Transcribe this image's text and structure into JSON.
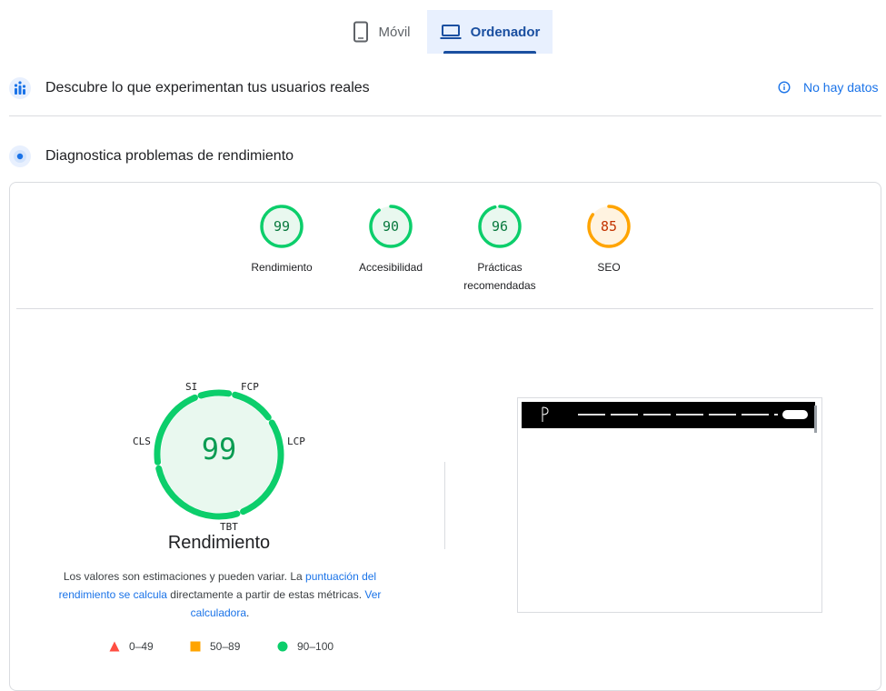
{
  "tabs": [
    {
      "label": "Móvil",
      "icon": "phone-icon",
      "selected": false
    },
    {
      "label": "Ordenador",
      "icon": "laptop-icon",
      "selected": true
    }
  ],
  "field_data": {
    "title": "Descubre lo que experimentan tus usuarios reales",
    "status": "No hay datos",
    "icon": "users-chart-icon"
  },
  "lab_data": {
    "title": "Diagnostica problemas de rendimiento",
    "icon": "diagnostics-icon"
  },
  "categories": [
    {
      "score": "99",
      "label": "Rendimiento",
      "color": "#0cce6b",
      "text_color": "#0a7a3f"
    },
    {
      "score": "90",
      "label": "Accesibilidad",
      "color": "#0cce6b",
      "text_color": "#0a7a3f"
    },
    {
      "score": "96",
      "label": "Prácticas recomendadas",
      "color": "#0cce6b",
      "text_color": "#0a7a3f"
    },
    {
      "score": "85",
      "label": "SEO",
      "color": "#ffa400",
      "text_color": "#c33300"
    }
  ],
  "performance": {
    "score": "99",
    "label": "Rendimiento",
    "metrics": [
      "SI",
      "FCP",
      "LCP",
      "TBT",
      "CLS"
    ],
    "note_text_1": "Los valores son estimaciones y pueden variar. La ",
    "note_link_1": "puntuación del rendimiento se calcula",
    "note_text_2": " directamente a partir de estas métricas. ",
    "note_link_2": "Ver calculadora",
    "note_text_3": "."
  },
  "legend": [
    {
      "range": "0–49",
      "shape": "triangle",
      "color": "#ff4e42"
    },
    {
      "range": "50–89",
      "shape": "square",
      "color": "#ffa400"
    },
    {
      "range": "90–100",
      "shape": "circle",
      "color": "#0cce6b"
    }
  ],
  "colors": {
    "accent": "#1a73e8",
    "pass": "#0cce6b",
    "average": "#ffa400",
    "fail": "#ff4e42"
  }
}
